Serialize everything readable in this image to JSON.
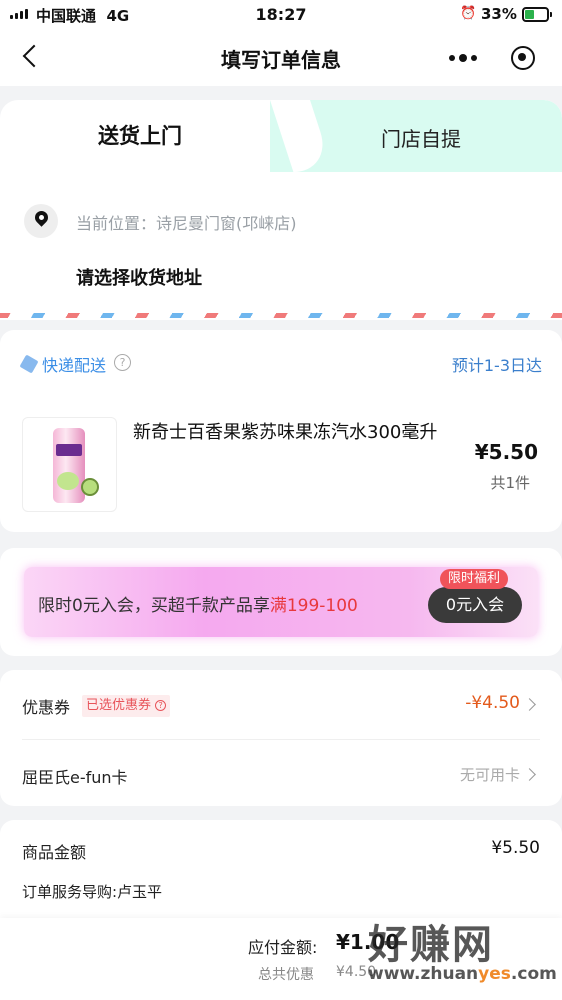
{
  "status_bar": {
    "carrier": "中国联通",
    "network": "4G",
    "time": "18:27",
    "battery_percent": "33%"
  },
  "nav": {
    "title": "填写订单信息",
    "icons": [
      "back-icon",
      "more-icon",
      "close-miniprogram-icon"
    ]
  },
  "delivery": {
    "tab_home": "送货上门",
    "tab_store": "门店自提",
    "location_label": "当前位置：诗尼曼门窗(邛崃店)",
    "address_prompt": "请选择收货地址"
  },
  "shipping": {
    "method": "快递配送",
    "eta": "预计1-3日达"
  },
  "product": {
    "name": "新奇士百香果紫苏味果冻汽水300毫升",
    "price": "¥5.50",
    "quantity": "共1件"
  },
  "promo": {
    "text_prefix": "限时0元入会，买超千款产品享",
    "text_highlight": "满199-100",
    "tag": "限时福利",
    "button": "0元入会"
  },
  "discounts": {
    "coupon_label": "优惠券",
    "coupon_chip": "已选优惠券",
    "coupon_value": "-¥4.50",
    "card_label": "屈臣氏e-fun卡",
    "card_value": "无可用卡"
  },
  "totals": {
    "subtotal_label": "商品金额",
    "subtotal_value": "¥5.50",
    "staff_label": "订单服务导购:卢玉平"
  },
  "bottom_bar": {
    "payable_label": "应付金额:",
    "payable_value": "¥1.00",
    "saved_label": "总共优惠",
    "saved_value": "¥4.50"
  },
  "watermark": {
    "big": "好赚网",
    "small_prefix": "www.zhuan",
    "small_yes": "yes",
    "small_suffix": ".com"
  },
  "colors": {
    "accent_blue": "#3b8ee6",
    "discount_orange": "#e35a1c",
    "promo_red": "#e8383d",
    "store_tab_bg": "#d9fbf1"
  }
}
